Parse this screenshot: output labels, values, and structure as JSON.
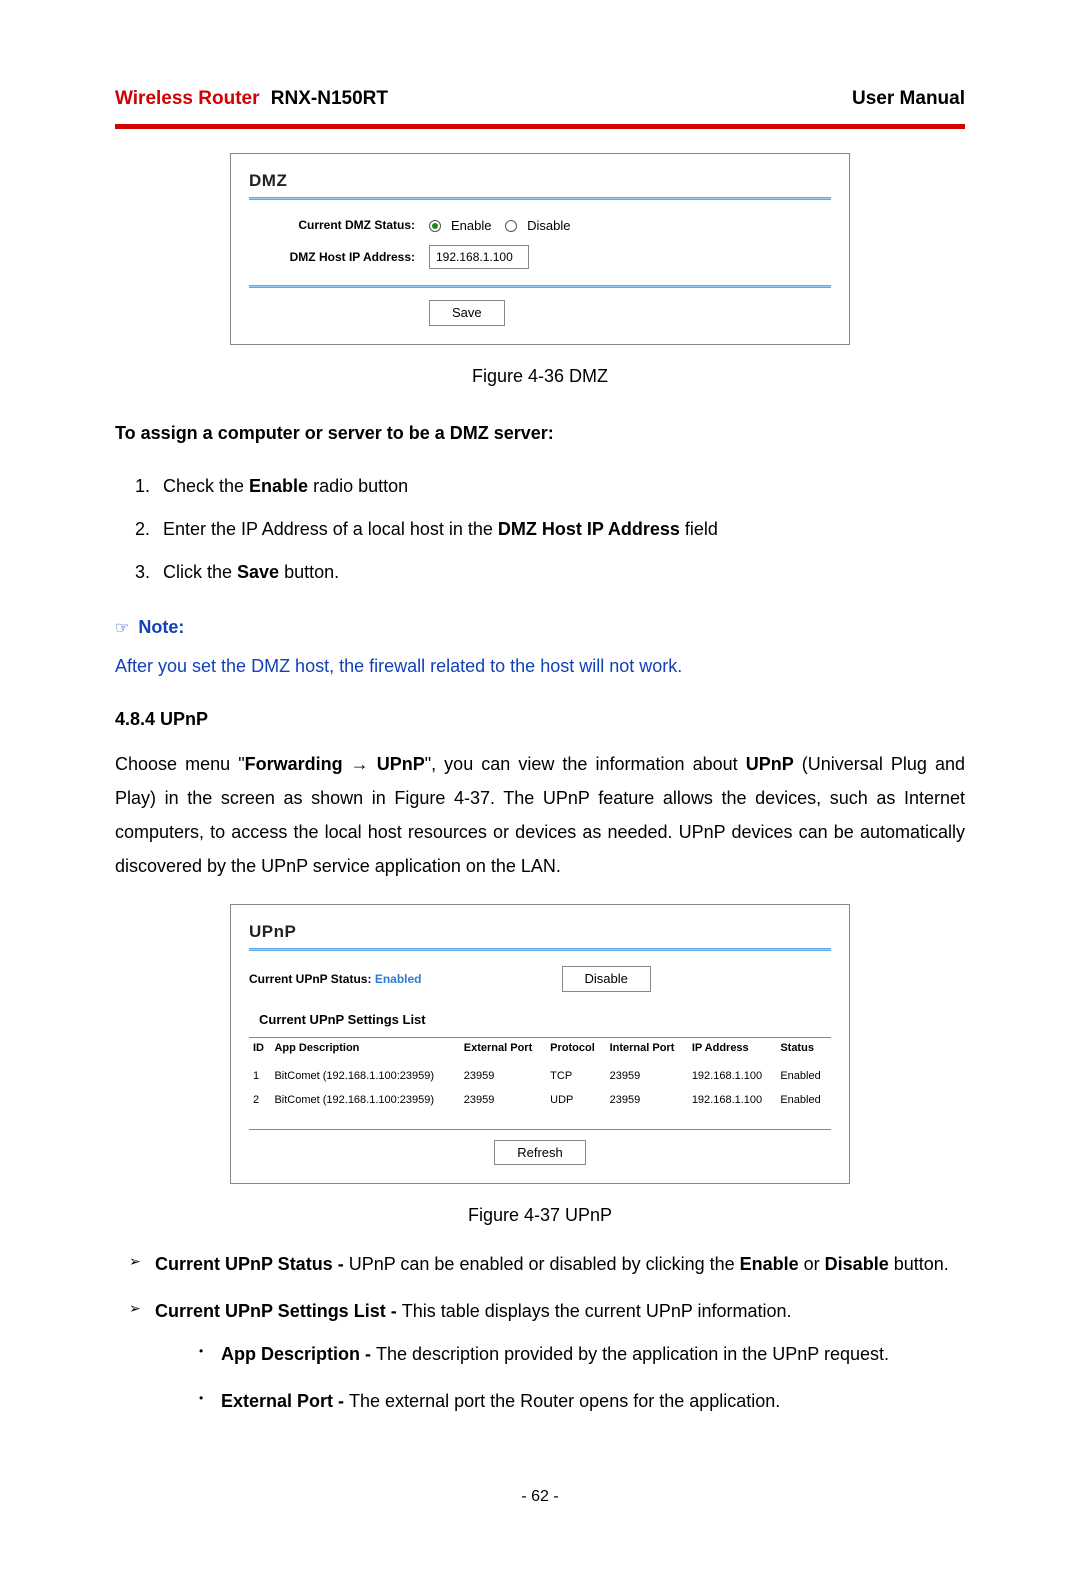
{
  "header": {
    "brand": "Wireless Router",
    "model": "RNX-N150RT",
    "right": "User Manual"
  },
  "dmz_panel": {
    "title": "DMZ",
    "status_label": "Current DMZ Status:",
    "enable": "Enable",
    "disable": "Disable",
    "ip_label": "DMZ Host IP Address:",
    "ip_value": "192.168.1.100",
    "save": "Save"
  },
  "fig1": "Figure 4-36    DMZ",
  "assign_head": "To assign a computer or server to be a DMZ server:",
  "steps": {
    "s1a": "Check the ",
    "s1b": "Enable",
    "s1c": " radio button",
    "s2a": "Enter the IP Address of a local host in the ",
    "s2b": "DMZ Host IP Address",
    "s2c": " field",
    "s3a": "Click the ",
    "s3b": "Save",
    "s3c": " button."
  },
  "note_label": "Note:",
  "note_body": "After you set the DMZ host, the firewall related to the host will not work.",
  "section_num": "4.8.4  UPnP",
  "para": {
    "p1a": "Choose menu \"",
    "p1b": "Forwarding → UPnP",
    "p1c": "\", you can view the information about ",
    "p1d": "UPnP",
    "p1e": " (Universal Plug and Play) in the screen as shown in Figure 4-37. The UPnP feature allows the devices, such as Internet computers, to access the local host resources or devices as needed. UPnP devices can be automatically discovered by the UPnP service application on the LAN."
  },
  "upnp_panel": {
    "title": "UPnP",
    "status_label": "Current UPnP Status:",
    "status_value": "Enabled",
    "disable_btn": "Disable",
    "list_title": "Current UPnP Settings List",
    "headers": {
      "id": "ID",
      "desc": "App Description",
      "ext": "External Port",
      "proto": "Protocol",
      "int": "Internal Port",
      "ip": "IP Address",
      "status": "Status"
    },
    "rows": [
      {
        "id": "1",
        "desc": "BitComet (192.168.1.100:23959)",
        "ext": "23959",
        "proto": "TCP",
        "int": "23959",
        "ip": "192.168.1.100",
        "status": "Enabled"
      },
      {
        "id": "2",
        "desc": "BitComet (192.168.1.100:23959)",
        "ext": "23959",
        "proto": "UDP",
        "int": "23959",
        "ip": "192.168.1.100",
        "status": "Enabled"
      }
    ],
    "refresh": "Refresh"
  },
  "fig2": "Figure 4-37 UPnP",
  "bullets": {
    "b1a": "Current UPnP Status - ",
    "b1b": "UPnP can be enabled or disabled by clicking the ",
    "b1c": "Enable",
    "b1d": " or ",
    "b1e": "Disable",
    "b1f": " button.",
    "b2a": "Current UPnP Settings List - ",
    "b2b": "This table displays the current UPnP information.",
    "s1a": "App Description - ",
    "s1b": "The description provided by the application in the UPnP request.",
    "s2a": "External Port - ",
    "s2b": "The external port the Router opens for the application."
  },
  "page_num": "- 62 -"
}
